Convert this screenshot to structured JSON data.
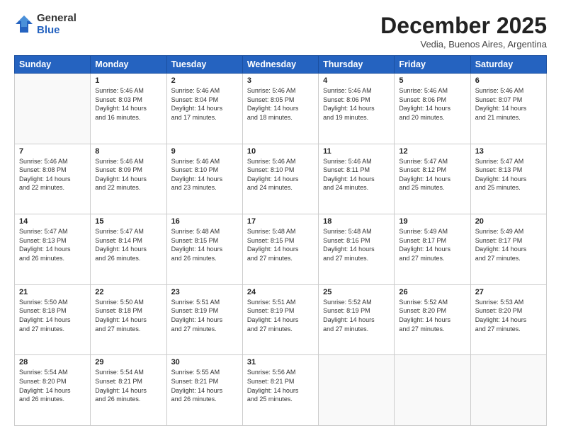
{
  "header": {
    "logo": {
      "general": "General",
      "blue": "Blue"
    },
    "title": "December 2025",
    "location": "Vedia, Buenos Aires, Argentina"
  },
  "calendar": {
    "days_of_week": [
      "Sunday",
      "Monday",
      "Tuesday",
      "Wednesday",
      "Thursday",
      "Friday",
      "Saturday"
    ],
    "weeks": [
      [
        {
          "day": "",
          "info": ""
        },
        {
          "day": "1",
          "info": "Sunrise: 5:46 AM\nSunset: 8:03 PM\nDaylight: 14 hours\nand 16 minutes."
        },
        {
          "day": "2",
          "info": "Sunrise: 5:46 AM\nSunset: 8:04 PM\nDaylight: 14 hours\nand 17 minutes."
        },
        {
          "day": "3",
          "info": "Sunrise: 5:46 AM\nSunset: 8:05 PM\nDaylight: 14 hours\nand 18 minutes."
        },
        {
          "day": "4",
          "info": "Sunrise: 5:46 AM\nSunset: 8:06 PM\nDaylight: 14 hours\nand 19 minutes."
        },
        {
          "day": "5",
          "info": "Sunrise: 5:46 AM\nSunset: 8:06 PM\nDaylight: 14 hours\nand 20 minutes."
        },
        {
          "day": "6",
          "info": "Sunrise: 5:46 AM\nSunset: 8:07 PM\nDaylight: 14 hours\nand 21 minutes."
        }
      ],
      [
        {
          "day": "7",
          "info": "Sunrise: 5:46 AM\nSunset: 8:08 PM\nDaylight: 14 hours\nand 22 minutes."
        },
        {
          "day": "8",
          "info": "Sunrise: 5:46 AM\nSunset: 8:09 PM\nDaylight: 14 hours\nand 22 minutes."
        },
        {
          "day": "9",
          "info": "Sunrise: 5:46 AM\nSunset: 8:10 PM\nDaylight: 14 hours\nand 23 minutes."
        },
        {
          "day": "10",
          "info": "Sunrise: 5:46 AM\nSunset: 8:10 PM\nDaylight: 14 hours\nand 24 minutes."
        },
        {
          "day": "11",
          "info": "Sunrise: 5:46 AM\nSunset: 8:11 PM\nDaylight: 14 hours\nand 24 minutes."
        },
        {
          "day": "12",
          "info": "Sunrise: 5:47 AM\nSunset: 8:12 PM\nDaylight: 14 hours\nand 25 minutes."
        },
        {
          "day": "13",
          "info": "Sunrise: 5:47 AM\nSunset: 8:13 PM\nDaylight: 14 hours\nand 25 minutes."
        }
      ],
      [
        {
          "day": "14",
          "info": "Sunrise: 5:47 AM\nSunset: 8:13 PM\nDaylight: 14 hours\nand 26 minutes."
        },
        {
          "day": "15",
          "info": "Sunrise: 5:47 AM\nSunset: 8:14 PM\nDaylight: 14 hours\nand 26 minutes."
        },
        {
          "day": "16",
          "info": "Sunrise: 5:48 AM\nSunset: 8:15 PM\nDaylight: 14 hours\nand 26 minutes."
        },
        {
          "day": "17",
          "info": "Sunrise: 5:48 AM\nSunset: 8:15 PM\nDaylight: 14 hours\nand 27 minutes."
        },
        {
          "day": "18",
          "info": "Sunrise: 5:48 AM\nSunset: 8:16 PM\nDaylight: 14 hours\nand 27 minutes."
        },
        {
          "day": "19",
          "info": "Sunrise: 5:49 AM\nSunset: 8:17 PM\nDaylight: 14 hours\nand 27 minutes."
        },
        {
          "day": "20",
          "info": "Sunrise: 5:49 AM\nSunset: 8:17 PM\nDaylight: 14 hours\nand 27 minutes."
        }
      ],
      [
        {
          "day": "21",
          "info": "Sunrise: 5:50 AM\nSunset: 8:18 PM\nDaylight: 14 hours\nand 27 minutes."
        },
        {
          "day": "22",
          "info": "Sunrise: 5:50 AM\nSunset: 8:18 PM\nDaylight: 14 hours\nand 27 minutes."
        },
        {
          "day": "23",
          "info": "Sunrise: 5:51 AM\nSunset: 8:19 PM\nDaylight: 14 hours\nand 27 minutes."
        },
        {
          "day": "24",
          "info": "Sunrise: 5:51 AM\nSunset: 8:19 PM\nDaylight: 14 hours\nand 27 minutes."
        },
        {
          "day": "25",
          "info": "Sunrise: 5:52 AM\nSunset: 8:19 PM\nDaylight: 14 hours\nand 27 minutes."
        },
        {
          "day": "26",
          "info": "Sunrise: 5:52 AM\nSunset: 8:20 PM\nDaylight: 14 hours\nand 27 minutes."
        },
        {
          "day": "27",
          "info": "Sunrise: 5:53 AM\nSunset: 8:20 PM\nDaylight: 14 hours\nand 27 minutes."
        }
      ],
      [
        {
          "day": "28",
          "info": "Sunrise: 5:54 AM\nSunset: 8:20 PM\nDaylight: 14 hours\nand 26 minutes."
        },
        {
          "day": "29",
          "info": "Sunrise: 5:54 AM\nSunset: 8:21 PM\nDaylight: 14 hours\nand 26 minutes."
        },
        {
          "day": "30",
          "info": "Sunrise: 5:55 AM\nSunset: 8:21 PM\nDaylight: 14 hours\nand 26 minutes."
        },
        {
          "day": "31",
          "info": "Sunrise: 5:56 AM\nSunset: 8:21 PM\nDaylight: 14 hours\nand 25 minutes."
        },
        {
          "day": "",
          "info": ""
        },
        {
          "day": "",
          "info": ""
        },
        {
          "day": "",
          "info": ""
        }
      ]
    ]
  }
}
